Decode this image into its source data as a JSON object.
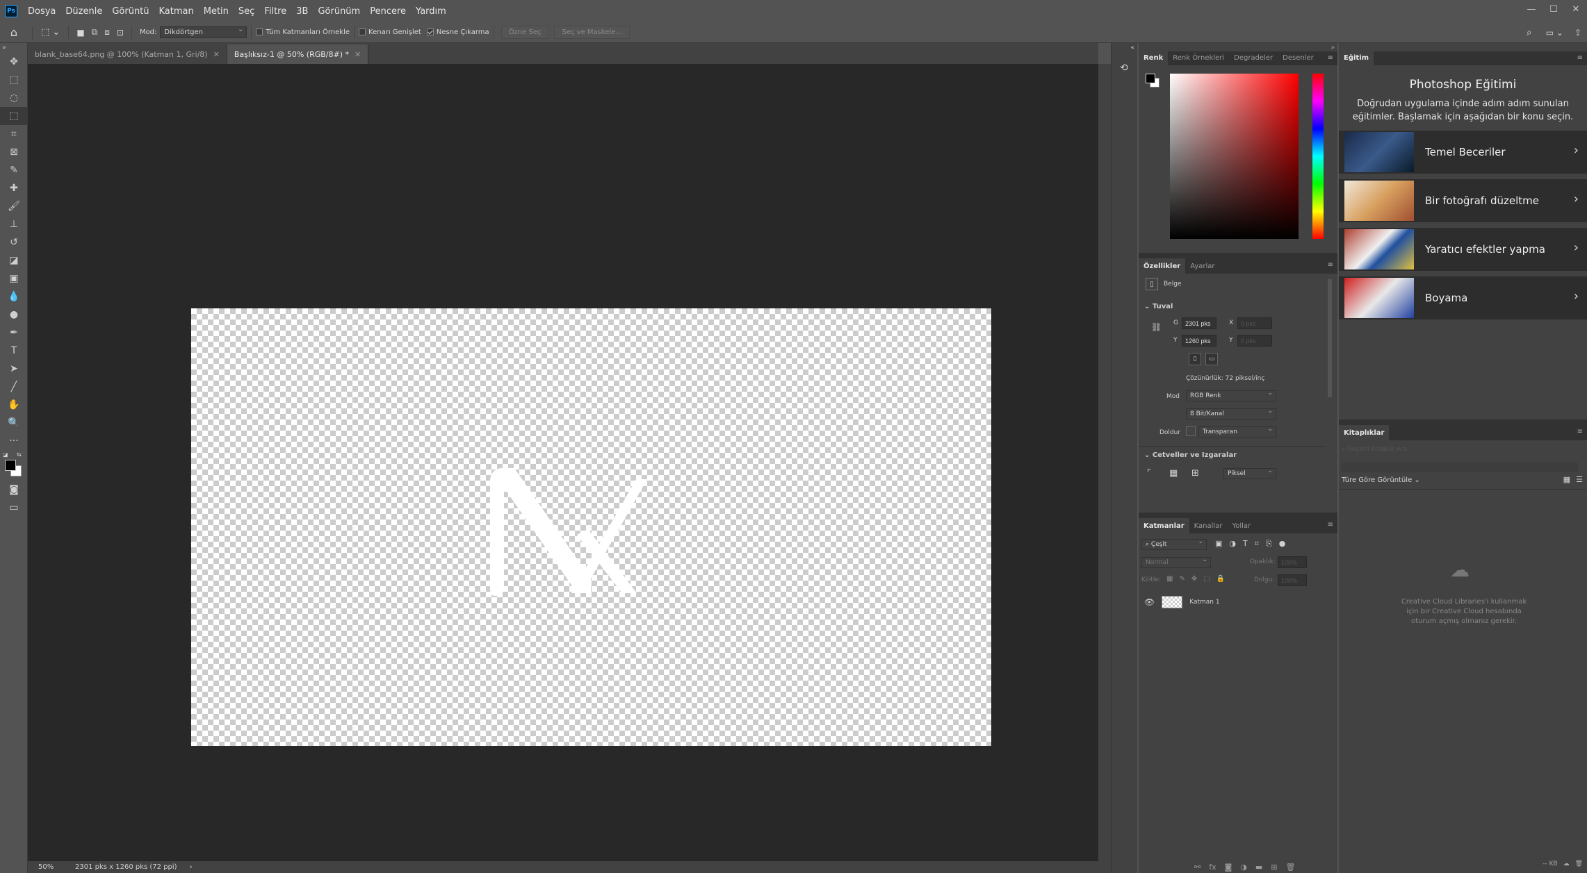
{
  "app": {
    "logo": "Ps"
  },
  "menu": [
    "Dosya",
    "Düzenle",
    "Görüntü",
    "Katman",
    "Metin",
    "Seç",
    "Filtre",
    "3B",
    "Görünüm",
    "Pencere",
    "Yardım"
  ],
  "options": {
    "mode_label": "Mod:",
    "mode_value": "Dikdörtgen",
    "sample_all": "Tüm Katmanları Örnekle",
    "enhance_edge": "Kenarı Genişlet",
    "object_subtract": "Nesne Çıkarma",
    "select_subject": "Özne Seç",
    "select_mask": "Seç ve Maskele..."
  },
  "tabs": [
    {
      "label": "blank_base64.png @ 100% (Katman 1, Gri/8)",
      "active": false
    },
    {
      "label": "Başlıksız-1 @ 50% (RGB/8#) *",
      "active": true
    }
  ],
  "status": {
    "zoom": "50%",
    "size": "2301 pks x 1260 pks (72 ppi)"
  },
  "color_panel": {
    "tabs": [
      "Renk",
      "Renk Örnekleri",
      "Degradeler",
      "Desenler"
    ],
    "hue_color": "#ff0000"
  },
  "properties": {
    "tabs": [
      "Özellikler",
      "Ayarlar"
    ],
    "doc_label": "Belge",
    "canvas_section": "Tuval",
    "w_label": "G",
    "w_value": "2301 pks",
    "h_label": "Y",
    "h_value": "1260 pks",
    "x_label": "X",
    "x_value": "0 pks",
    "y_label": "Y",
    "y_value": "0 pks",
    "resolution": "Çözünürlük: 72 piksel/inç",
    "mode_label": "Mod",
    "mode_value": "RGB Renk",
    "depth_value": "8 Bit/Kanal",
    "fill_label": "Doldur",
    "fill_value": "Transparan",
    "rulers_section": "Cetveller ve Izgaralar",
    "units_value": "Piksel"
  },
  "layers": {
    "tabs": [
      "Katmanlar",
      "Kanallar",
      "Yollar"
    ],
    "filter": "Çeşit",
    "blend": "Normal",
    "opacity_label": "Opaklık:",
    "opacity_value": "100%",
    "lock_label": "Kilitle:",
    "fill_label": "Dolgu:",
    "fill_value": "100%",
    "items": [
      {
        "name": "Katman 1",
        "visible": true
      }
    ]
  },
  "learn": {
    "tab": "Eğitim",
    "title": "Photoshop Eğitimi",
    "desc": "Doğrudan uygulama içinde adım adım sunulan eğitimler. Başlamak için aşağıdan bir konu seçin.",
    "items": [
      "Temel Beceriler",
      "Bir fotoğrafı düzeltme",
      "Yaratıcı efektler yapma",
      "Boyama"
    ]
  },
  "libraries": {
    "tab": "Kitaplıklar",
    "search_placeholder": "Geçerli Kitaplık Ara",
    "view_label": "Türe Göre Görüntüle",
    "empty_msg": "Creative Cloud Libraries'i kullanmak için bir Creative Cloud hesabında oturum açmış olmanız gerekir.",
    "size": "-- KB"
  },
  "canvas_logo": "NX"
}
